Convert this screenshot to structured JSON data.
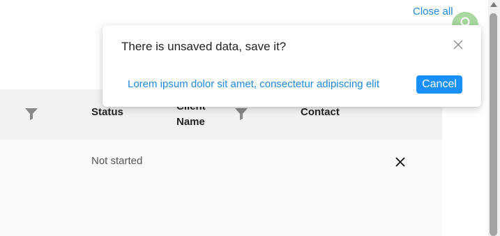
{
  "header": {
    "close_all_label": "Close all"
  },
  "table": {
    "columns": {
      "status": "Status",
      "client_name": "Client Name",
      "contact": "Contact"
    },
    "rows": [
      {
        "status": "Not started"
      }
    ]
  },
  "notification": {
    "title": "There is unsaved data, save it?",
    "link_text": "Lorem ipsum dolor sit amet, consectetur adipiscing elit",
    "cancel_label": "Cancel"
  },
  "colors": {
    "accent": "#1e88e5",
    "button": "#1890ff",
    "avatar": "#a9d8a0",
    "table_header_bg": "#f2f2f2"
  },
  "icons": [
    "filter-icon",
    "close-icon",
    "user-icon"
  ]
}
